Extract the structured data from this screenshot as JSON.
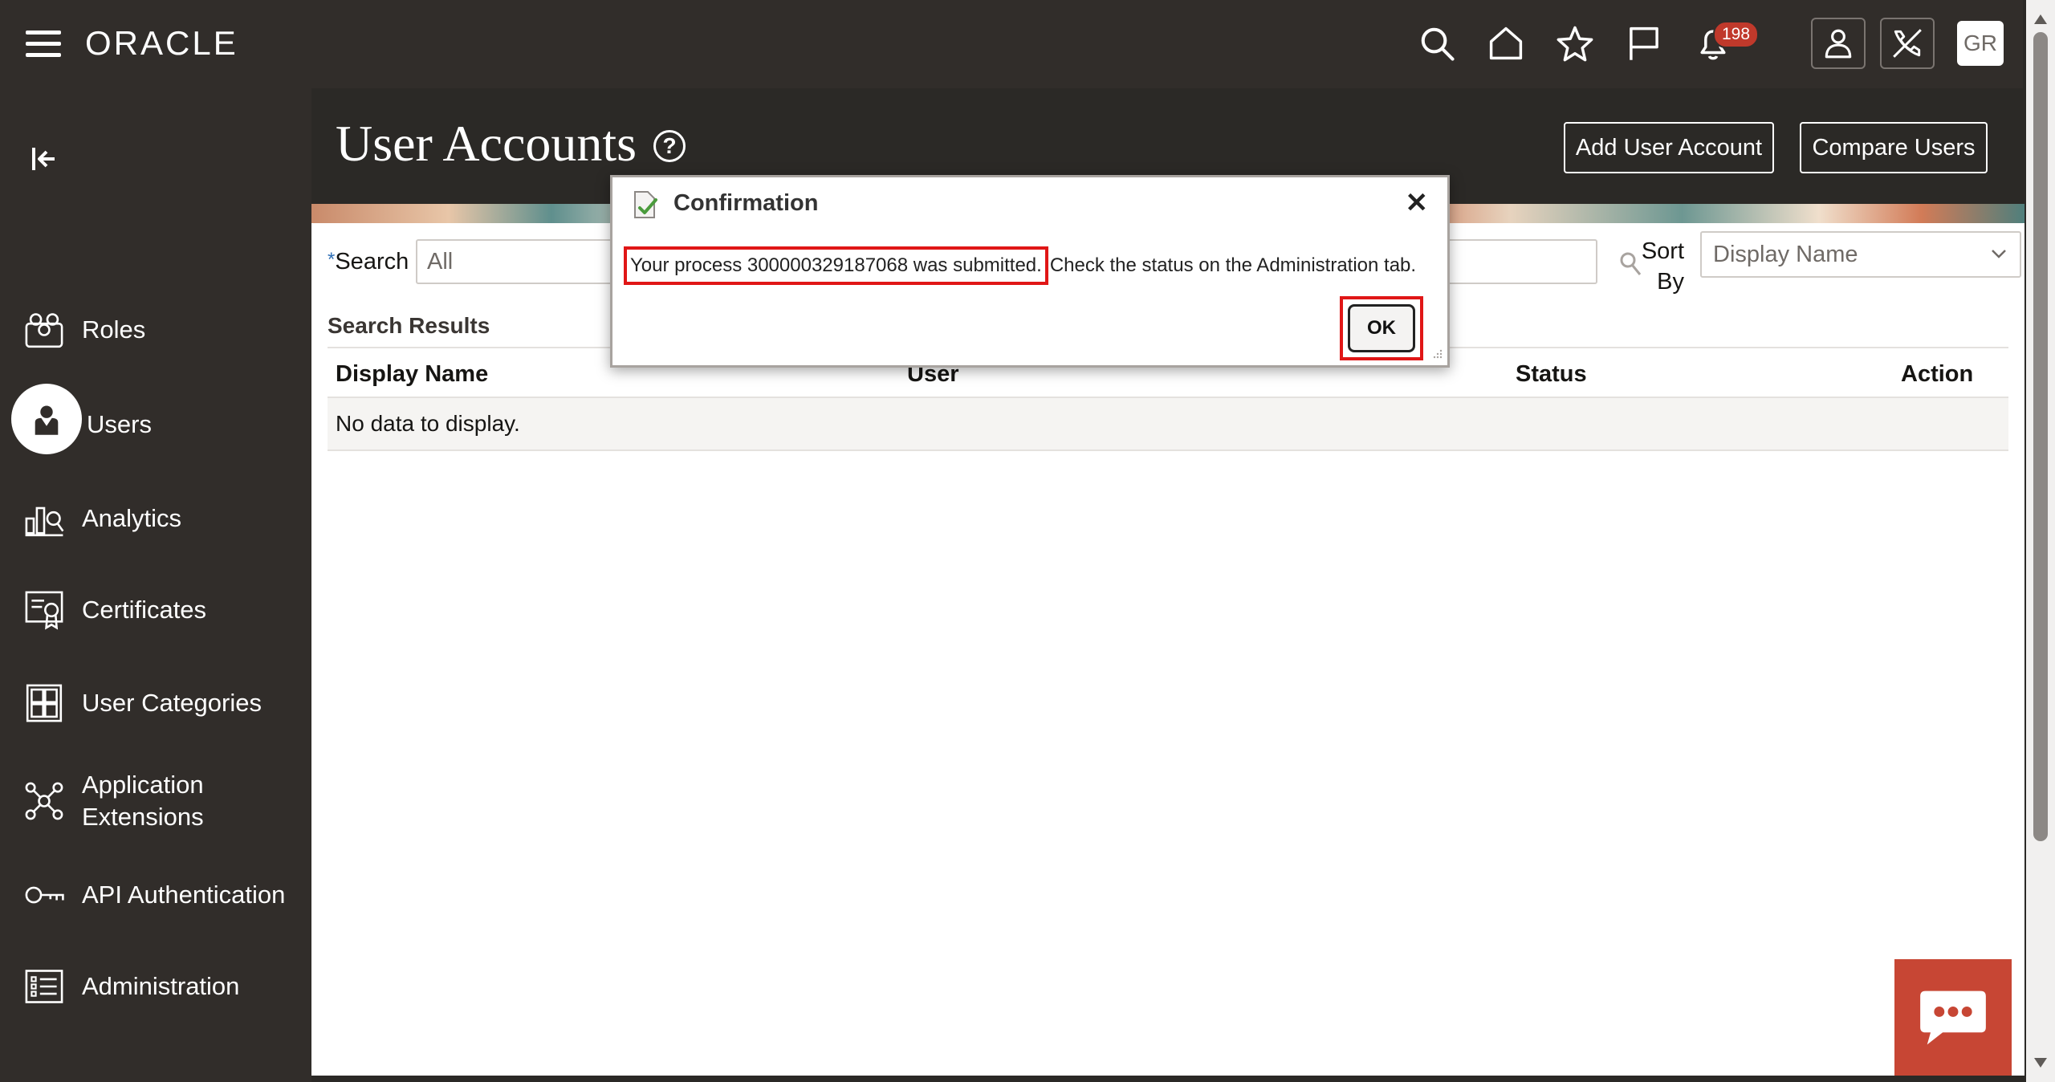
{
  "topbar": {
    "brand": "ORACLE",
    "notification_count": "198",
    "avatar_initials": "GR"
  },
  "sidebar": {
    "items": [
      {
        "label": "Roles",
        "icon": "roles-icon"
      },
      {
        "label": "Users",
        "icon": "users-icon"
      },
      {
        "label": "Analytics",
        "icon": "analytics-icon"
      },
      {
        "label": "Certificates",
        "icon": "certificate-icon"
      },
      {
        "label": "User Categories",
        "icon": "user-categories-icon"
      },
      {
        "label": "Application Extensions",
        "icon": "application-extensions-icon"
      },
      {
        "label": "API Authentication",
        "icon": "key-icon"
      },
      {
        "label": "Administration",
        "icon": "administration-icon"
      }
    ],
    "active": "Users"
  },
  "header": {
    "title": "User Accounts",
    "help_symbol": "?",
    "add_user_label": "Add User Account",
    "compare_users_label": "Compare Users"
  },
  "search": {
    "label": "Search",
    "required_mark": "*",
    "value": "All",
    "sort_by_label": "Sort By",
    "sort_value": "Display Name"
  },
  "results": {
    "title": "Search Results",
    "columns": [
      "Display Name",
      "User",
      "Status",
      "Action"
    ],
    "empty_message": "No data to display."
  },
  "dialog": {
    "title": "Confirmation",
    "close_symbol": "✕",
    "message_highlight": "Your process 300000329187068 was submitted.",
    "message_rest": "Check the status on the Administration tab.",
    "ok_label": "OK"
  },
  "colors": {
    "shell_bg": "#312d2a",
    "highlight_red": "#e01616",
    "chat_red": "#c74634",
    "badge_red": "#c0392b"
  }
}
